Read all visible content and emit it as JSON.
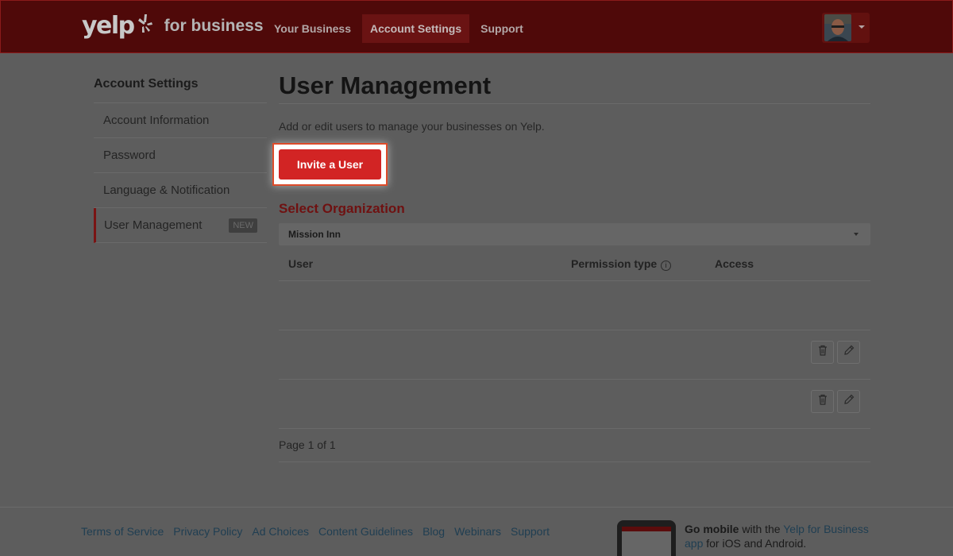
{
  "header": {
    "logo_text": "yelp",
    "logo_suffix": "for business",
    "nav": [
      {
        "label": "Your Business"
      },
      {
        "label": "Account Settings"
      },
      {
        "label": "Support"
      }
    ]
  },
  "sidebar": {
    "title": "Account Settings",
    "items": [
      {
        "label": "Account Information"
      },
      {
        "label": "Password"
      },
      {
        "label": "Language & Notification"
      },
      {
        "label": "User Management",
        "badge": "NEW"
      }
    ]
  },
  "main": {
    "title": "User Management",
    "description": "Add or edit users to manage your businesses on Yelp.",
    "invite_label": "Invite a User",
    "select_org_label": "Select Organization",
    "org_selected": "Mission Inn",
    "table": {
      "col_user": "User",
      "col_permission": "Permission type",
      "col_access": "Access",
      "info_glyph": "i"
    },
    "pagination": "Page 1 of 1"
  },
  "footer": {
    "links": [
      "Terms of Service",
      "Privacy Policy",
      "Ad Choices",
      "Content Guidelines",
      "Blog",
      "Webinars",
      "Support"
    ],
    "mobile_bold": "Go mobile",
    "mobile_with": " with the ",
    "mobile_link": "Yelp for Business app",
    "mobile_tail": " for iOS and Android."
  },
  "colors": {
    "brand_red": "#d32323",
    "overlay_header": "#4f0909",
    "highlight_border": "#dc4b2a"
  },
  "icons": [
    "yelp-burst-icon",
    "info-icon",
    "trash-icon",
    "pencil-icon",
    "chevron-down-icon"
  ]
}
